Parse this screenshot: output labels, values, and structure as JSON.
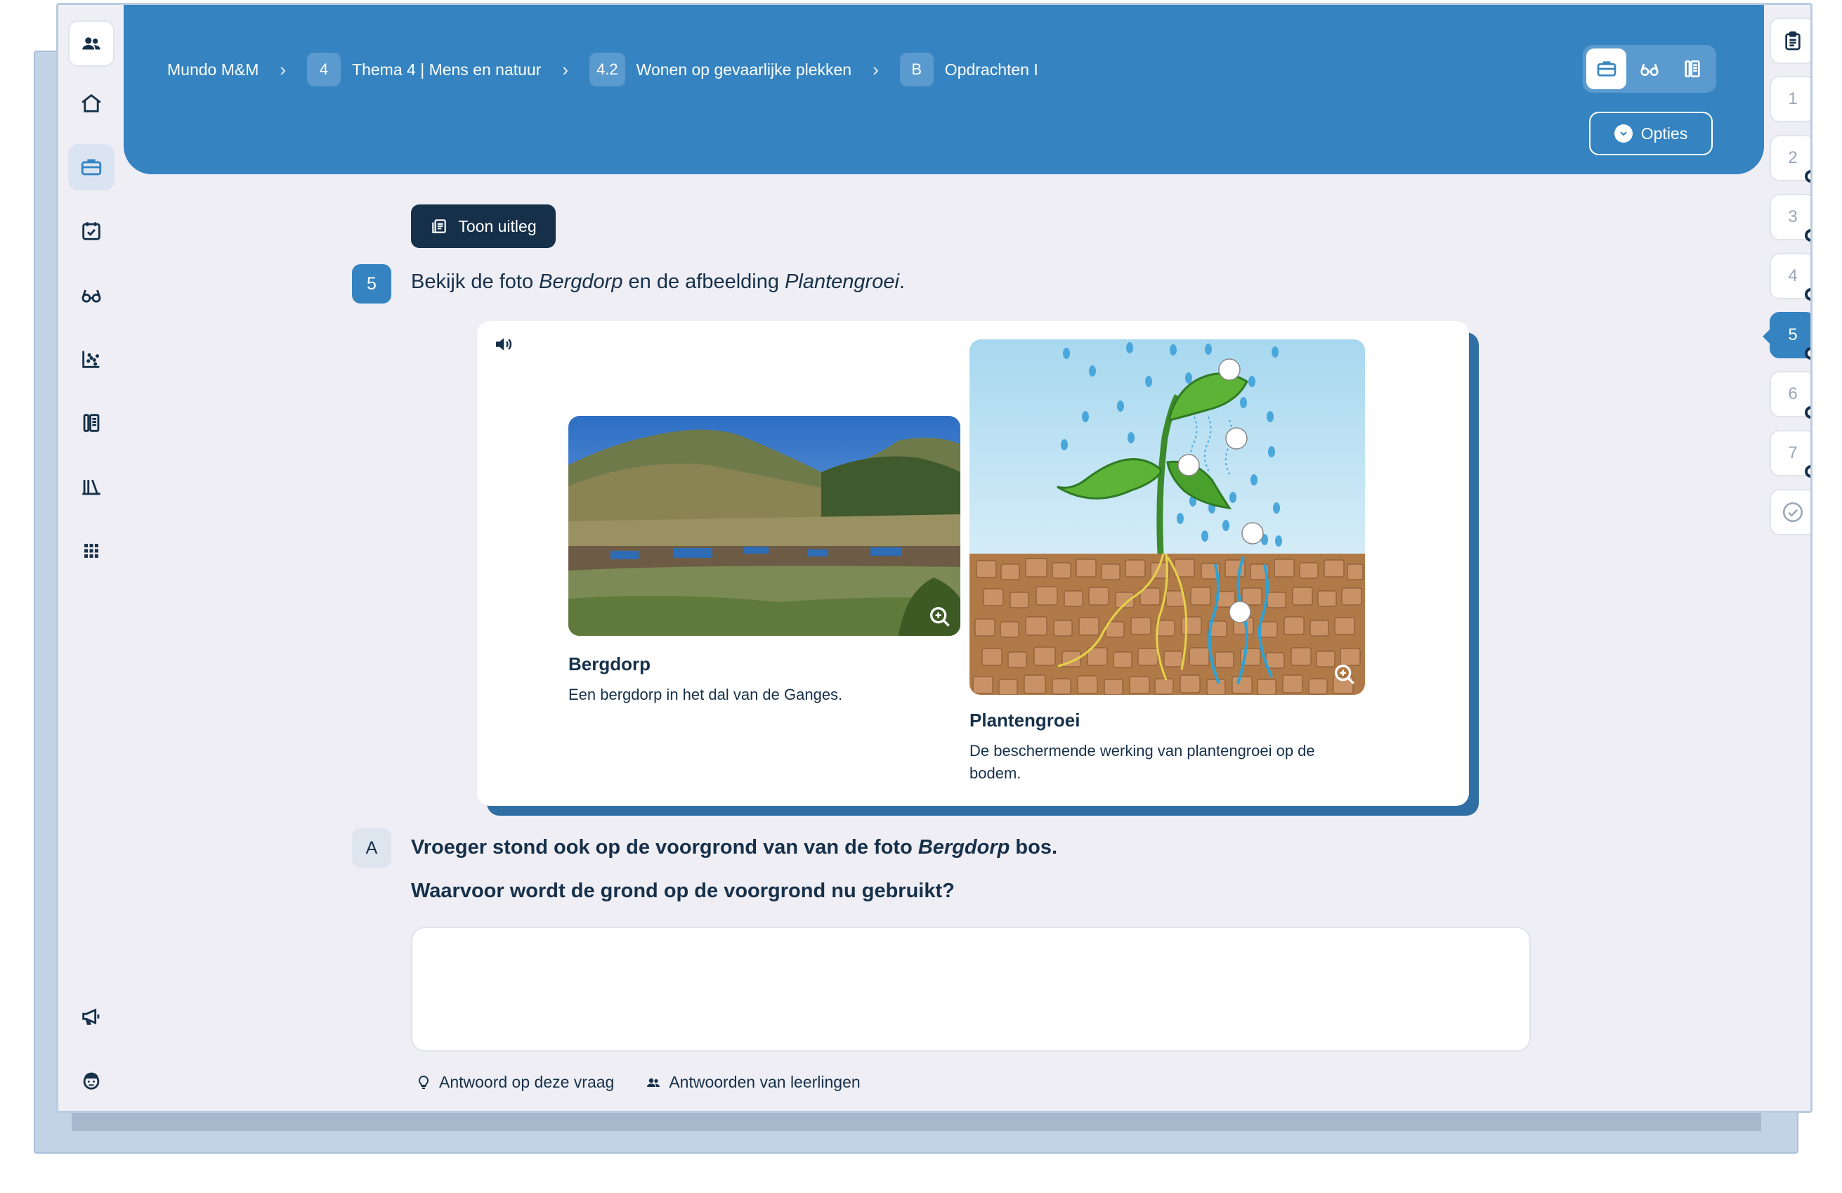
{
  "breadcrumb": [
    {
      "badge": "",
      "label": "Mundo M&M"
    },
    {
      "badge": "4",
      "label": "Thema 4 | Mens en natuur"
    },
    {
      "badge": "4.2",
      "label": "Wonen op gevaarlijke plekken"
    },
    {
      "badge": "B",
      "label": "Opdrachten I"
    }
  ],
  "breadcrumb_separator": "›",
  "header": {
    "options_label": "Opties"
  },
  "sidebar": {
    "items": [
      "users-icon",
      "home-icon",
      "briefcase-icon",
      "calendar-check-icon",
      "glasses-icon",
      "chart-icon",
      "books-icon",
      "library-icon",
      "grid-icon",
      "megaphone-icon",
      "avatar-icon"
    ]
  },
  "rightnav": {
    "items": [
      {
        "label": "1",
        "dot": false
      },
      {
        "label": "2",
        "dot": true
      },
      {
        "label": "3",
        "dot": true
      },
      {
        "label": "4",
        "dot": true
      },
      {
        "label": "5",
        "dot": true,
        "active": true
      },
      {
        "label": "6",
        "dot": true
      },
      {
        "label": "7",
        "dot": true
      }
    ]
  },
  "main": {
    "toon_uitleg": "Toon uitleg",
    "question": {
      "number": "5",
      "prefix": "Bekijk de foto ",
      "italic1": "Bergdorp",
      "middle": " en de afbeelding ",
      "italic2": "Plantengroei",
      "suffix": "."
    },
    "media": [
      {
        "title": "Bergdorp",
        "caption": "Een bergdorp in het dal van de Ganges."
      },
      {
        "title": "Plantengroei",
        "caption": "De beschermende werking van plantengroei op de bodem."
      }
    ],
    "sub": {
      "letter": "A",
      "line1_prefix": "Vroeger stond ook op de voorgrond van van de foto ",
      "line1_italic": "Bergdorp",
      "line1_suffix": " bos.",
      "line2": "Waarvoor wordt de grond op de voorgrond nu gebruikt?"
    },
    "footer": {
      "answer_label": "Antwoord op deze vraag",
      "students_label": "Antwoorden van leerlingen"
    }
  },
  "colors": {
    "primary": "#3584c1",
    "dark": "#16304a",
    "background": "#eeeef4"
  }
}
